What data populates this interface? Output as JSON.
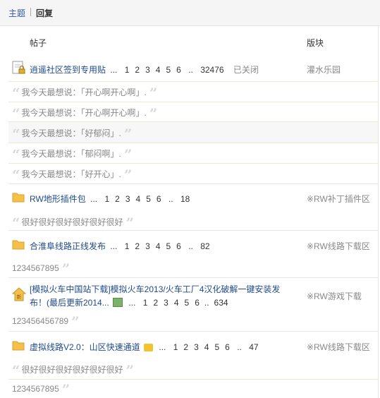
{
  "tabs": {
    "topic": "主题",
    "reply": "回复"
  },
  "headers": {
    "post": "帖子",
    "forum": "版块"
  },
  "threads": [
    {
      "title": "逍遥社区签到专用贴",
      "pages": [
        "1",
        "2",
        "3",
        "4",
        "5",
        "6"
      ],
      "last_page": "32476",
      "status": "已关闭",
      "forum": "灌水乐园",
      "replies": [
        "我今天最想说：「开心啊开心啊」.",
        "我今天最想说：「开心啊开心啊」.",
        "我今天最想说：「好郁闷」.",
        "我今天最想说：「郁闷啊」.",
        "我今天最想说：「好开心」."
      ]
    },
    {
      "title": "RW地形插件包",
      "pages": [
        "1",
        "2",
        "3",
        "4",
        "5",
        "6"
      ],
      "last_page": "18",
      "forum": "※RW补丁插件区",
      "replies": [
        "很好很好很好很好很好很好"
      ]
    },
    {
      "title": "合淮阜线路正线发布",
      "pages": [
        "1",
        "2",
        "3",
        "4",
        "5",
        "6"
      ],
      "last_page": "82",
      "forum": "※RW线路下载区",
      "replies": [
        "1234567895"
      ]
    },
    {
      "title_line1": "[模拟火车中国站下载]模拟火车2013/火车工厂4汉化破解一键安装发",
      "title_line2": "布！(最后更新2014...",
      "pages": [
        "1",
        "2",
        "3",
        "4",
        "5",
        "6"
      ],
      "last_page": "634",
      "forum": "※RW游戏下载",
      "replies": [
        "123456456789"
      ]
    },
    {
      "title": "虚拟线路V2.0：山区快速通道",
      "pages": [
        "1",
        "2",
        "3",
        "4",
        "5",
        "6"
      ],
      "last_page": "47",
      "forum": "※RW线路下载区",
      "replies": [
        "很好很好很好很好很好很好",
        "1234567895"
      ]
    }
  ],
  "ellipsis": "...",
  "dots2": "..",
  "quote_open": "“",
  "quote_close": "”",
  "icons": {
    "locked_thread": "locked-thread-icon",
    "folder": "folder-icon",
    "hot_thread": "hot-thread-icon",
    "image_attachment": "image-attachment-icon",
    "highlight": "highlight-icon"
  },
  "colors": {
    "link": "#1f4a8a",
    "quote": "#d8d8d8",
    "folder": "#f5c04a"
  }
}
